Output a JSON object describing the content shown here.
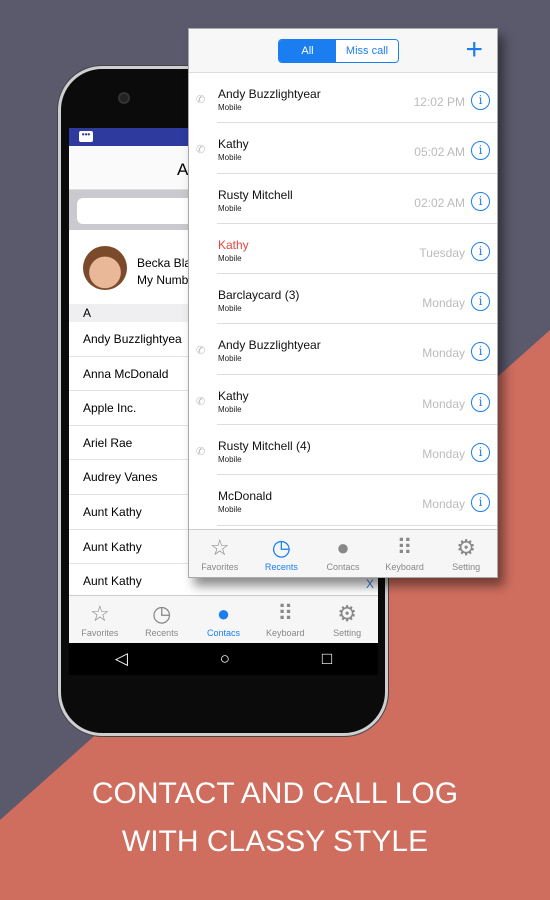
{
  "colors": {
    "accent": "#1a7ef0",
    "missed": "#e8463a",
    "bg_top": "#5b5a6d",
    "bg_bottom": "#cf6e5f"
  },
  "contacts_screen": {
    "title": "A",
    "profile": {
      "name": "Becka Bla",
      "number": "My Numb"
    },
    "section": "A",
    "contacts": [
      "Andy  Buzzlightyea",
      "Anna  McDonald",
      "Apple Inc.",
      "Ariel  Rae",
      "Audrey  Vanes",
      "Aunt  Kathy",
      "Aunt  Kathy",
      "Aunt  Kathy"
    ],
    "ad_close": "X",
    "tabs": [
      {
        "label": "Favorites",
        "icon": "star-icon"
      },
      {
        "label": "Recents",
        "icon": "clock-icon"
      },
      {
        "label": "Contacs",
        "icon": "person-icon",
        "active": true
      },
      {
        "label": "Keyboard",
        "icon": "keypad-icon"
      },
      {
        "label": "Setting",
        "icon": "gear-icon"
      }
    ]
  },
  "recents_screen": {
    "segments": {
      "all": "All",
      "missed": "Miss call",
      "selected": "All"
    },
    "rows": [
      {
        "name": "Andy  Buzzlightyear",
        "type": "Mobile",
        "time": "12:02 PM",
        "outgoing": true
      },
      {
        "name": "Kathy",
        "type": "Mobile",
        "time": "05:02 AM",
        "outgoing": true
      },
      {
        "name": "Rusty Mitchell",
        "type": "Mobile",
        "time": "02:02 AM"
      },
      {
        "name": "Kathy",
        "type": "Mobile",
        "time": "Tuesday",
        "missed": true
      },
      {
        "name": "Barclaycard (3)",
        "type": "Mobile",
        "time": "Monday"
      },
      {
        "name": "Andy  Buzzlightyear",
        "type": "Mobile",
        "time": "Monday",
        "outgoing": true
      },
      {
        "name": "Kathy",
        "type": "Mobile",
        "time": "Monday",
        "outgoing": true
      },
      {
        "name": "Rusty Mitchell (4)",
        "type": "Mobile",
        "time": "Monday",
        "outgoing": true
      },
      {
        "name": "McDonald",
        "type": "Mobile",
        "time": "Monday"
      }
    ],
    "tabs": [
      {
        "label": "Favorites",
        "icon": "star-icon"
      },
      {
        "label": "Recents",
        "icon": "clock-icon",
        "active": true
      },
      {
        "label": "Contacs",
        "icon": "person-icon"
      },
      {
        "label": "Keyboard",
        "icon": "keypad-icon"
      },
      {
        "label": "Setting",
        "icon": "gear-icon"
      }
    ]
  },
  "headline": {
    "line1": "CONTACT AND CALL LOG",
    "line2": "WITH CLASSY STYLE"
  }
}
